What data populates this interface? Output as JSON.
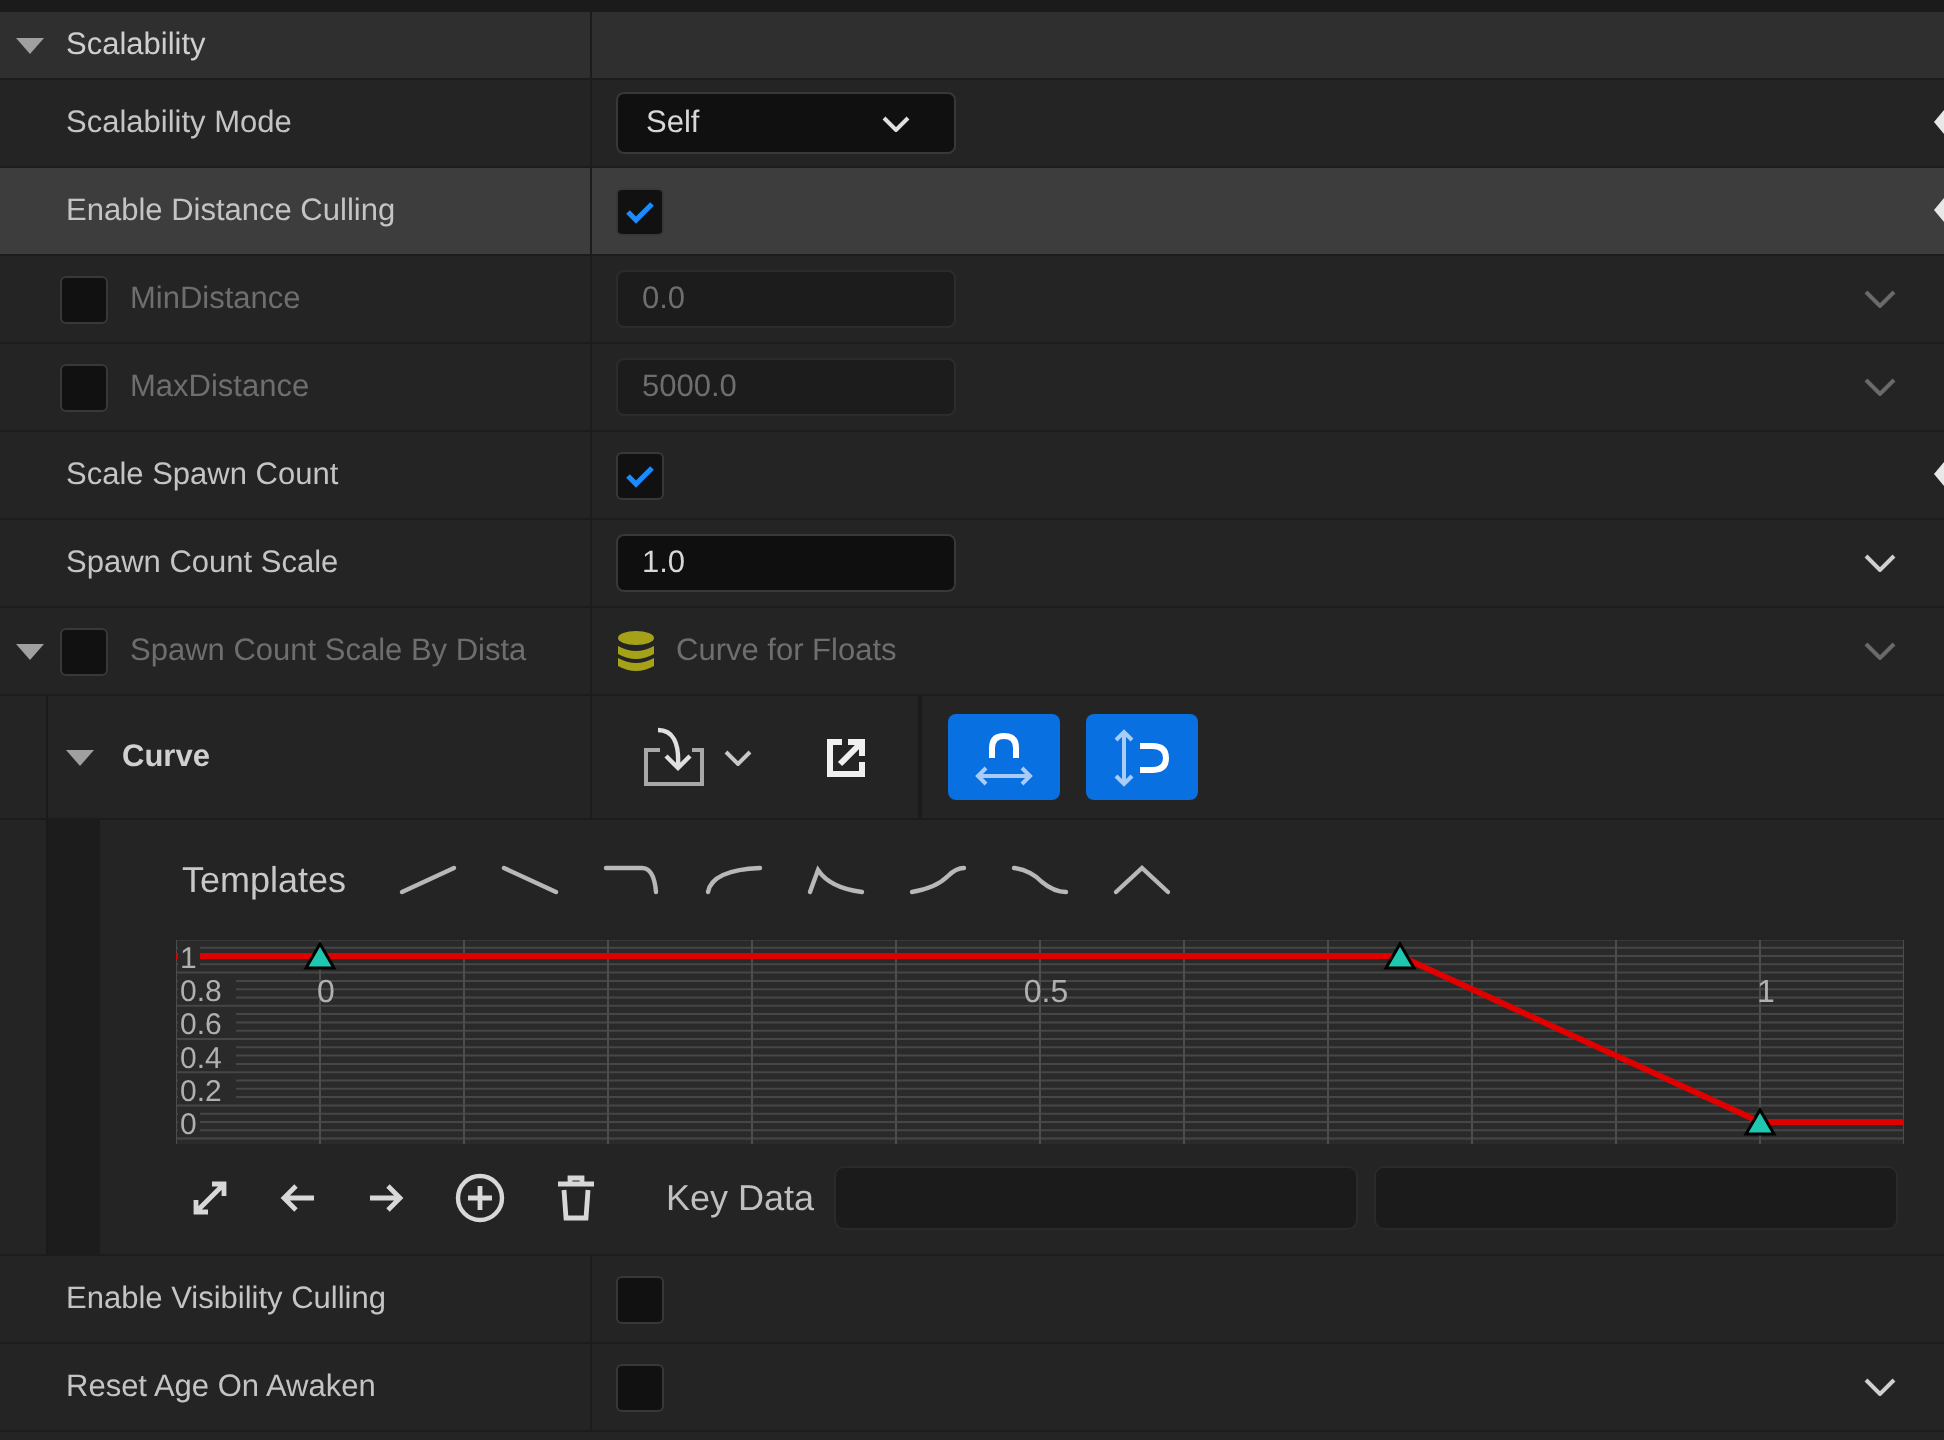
{
  "section": {
    "title": "Scalability",
    "expanded": true
  },
  "rows": [
    {
      "kind": "dropdown",
      "label": "Scalability Mode",
      "value": "Self",
      "disabled": false,
      "highlighted": false,
      "reset": true,
      "chevron": false
    },
    {
      "kind": "checkbox",
      "label": "Enable Distance Culling",
      "checked": true,
      "disabled": false,
      "highlighted": true,
      "reset": true,
      "chevron": false
    },
    {
      "kind": "number",
      "label": "MinDistance",
      "value": "0.0",
      "edit_condition": {
        "checked": false
      },
      "disabled": true,
      "highlighted": false,
      "reset": false,
      "chevron": true
    },
    {
      "kind": "number",
      "label": "MaxDistance",
      "value": "5000.0",
      "edit_condition": {
        "checked": false
      },
      "disabled": true,
      "highlighted": false,
      "reset": false,
      "chevron": true
    },
    {
      "kind": "checkbox",
      "label": "Scale Spawn Count",
      "checked": true,
      "disabled": false,
      "highlighted": false,
      "reset": true,
      "chevron": false
    },
    {
      "kind": "number",
      "label": "Spawn Count Scale",
      "value": "1.0",
      "disabled": false,
      "highlighted": false,
      "reset": false,
      "chevron": true
    },
    {
      "kind": "asset",
      "label": "Spawn Count Scale By Dista",
      "value": "Curve for Floats",
      "expanded": true,
      "edit_condition": {
        "checked": false
      },
      "disabled": true,
      "highlighted": false,
      "reset": false,
      "chevron": true
    },
    {
      "kind": "curve",
      "label": "Curve",
      "expanded": true,
      "snap_buttons": [
        {
          "on": true
        },
        {
          "on": true
        }
      ],
      "templates_label": "Templates",
      "key_data_label": "Key Data",
      "chart_data": {
        "type": "line",
        "grid": true,
        "x": [
          -0.1,
          0,
          0.75,
          1,
          1.1
        ],
        "series": [
          {
            "color": "#e00000",
            "marker": "triangle",
            "values": [
              1,
              1,
              1,
              0,
              0
            ]
          }
        ],
        "xlim": [
          -0.1,
          1.1
        ],
        "ylim": [
          -0.1,
          1.1
        ],
        "xticks": [
          {
            "value": 0,
            "label": "0"
          },
          {
            "value": 0.5,
            "label": "0.5"
          },
          {
            "value": 1,
            "label": "1"
          }
        ],
        "yticks": [
          {
            "value": 0,
            "label": "0"
          },
          {
            "value": 0.2,
            "label": "0.2"
          },
          {
            "value": 0.4,
            "label": "0.4"
          },
          {
            "value": 0.6,
            "label": "0.6"
          },
          {
            "value": 0.8,
            "label": "0.8"
          },
          {
            "value": 1,
            "label": "1"
          }
        ]
      }
    },
    {
      "kind": "checkbox",
      "label": "Enable Visibility Culling",
      "checked": false,
      "disabled": false,
      "highlighted": false,
      "reset": false,
      "chevron": false
    },
    {
      "kind": "checkbox",
      "label": "Reset Age On Awaken",
      "checked": false,
      "disabled": false,
      "highlighted": false,
      "reset": false,
      "chevron": true
    }
  ]
}
